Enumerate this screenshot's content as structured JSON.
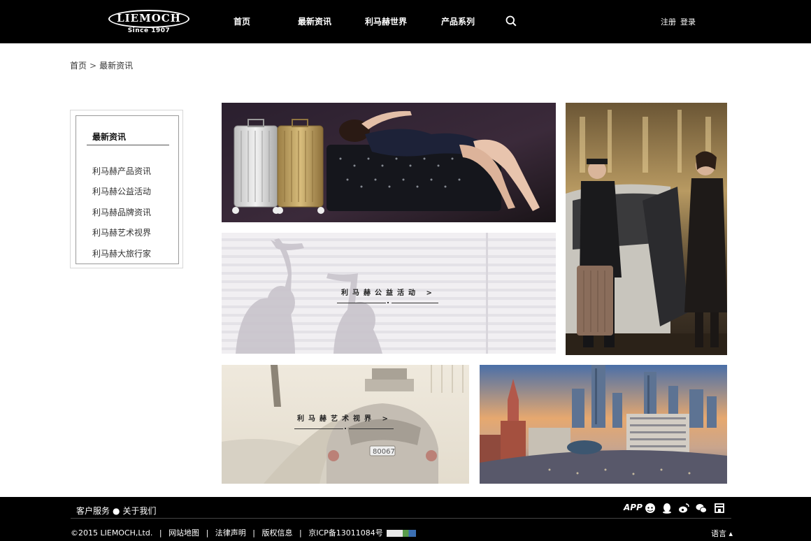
{
  "brand": {
    "logo_text": "LIEMOCH",
    "tagline": "Since 1907"
  },
  "nav": {
    "items": [
      {
        "label": "首页"
      },
      {
        "label": "最新资讯"
      },
      {
        "label": "利马赫世界"
      },
      {
        "label": "产品系列"
      }
    ],
    "search_icon": "search-icon",
    "register": "注册",
    "login": "登录"
  },
  "breadcrumb": {
    "home": "首页",
    "separator": ">",
    "current": "最新资讯"
  },
  "sidebar": {
    "title": "最新资讯",
    "items": [
      {
        "label": "利马赫产品资讯"
      },
      {
        "label": "利马赫公益活动"
      },
      {
        "label": "利马赫品牌资讯"
      },
      {
        "label": "利马赫艺术视界"
      },
      {
        "label": "利马赫大旅行家"
      }
    ]
  },
  "tiles": {
    "charity": {
      "label": "利马赫公益活动 >"
    },
    "art": {
      "label": "利马赫艺术视界 >"
    }
  },
  "footer": {
    "service": "客户服务",
    "bullet": "●",
    "about": "关于我们",
    "copyright": "©2015 LIEMOCH,Ltd.",
    "sitemap": "网站地图",
    "legal": "法律声明",
    "rights": "版权信息",
    "icp": "京ICP备13011084号",
    "sep": "|",
    "app": "APP",
    "language": "语言 ▴",
    "icons": [
      "chat-bubble-icon",
      "qq-penguin-icon",
      "weibo-icon",
      "wechat-icon",
      "store-icon"
    ]
  },
  "colors": {
    "header_bg": "#000000",
    "footer_bg": "#000000",
    "page_bg": "#ffffff"
  }
}
